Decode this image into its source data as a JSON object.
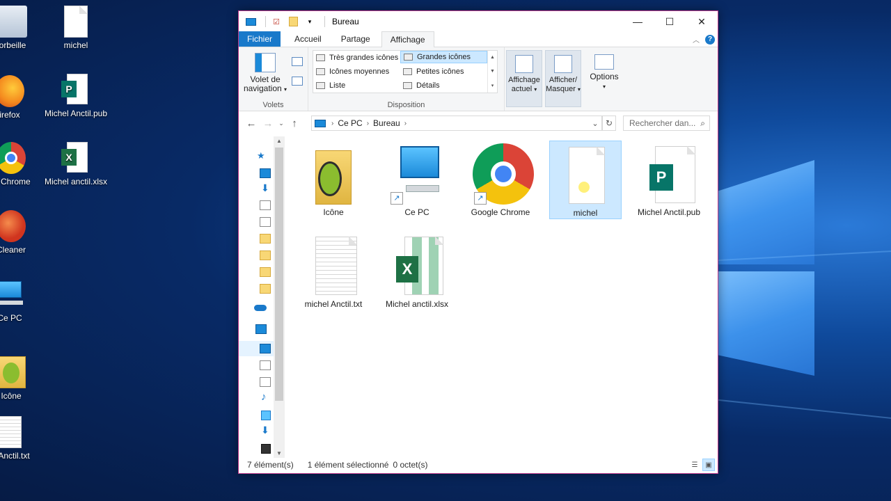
{
  "desktop": {
    "icons": [
      {
        "label": "orbeille"
      },
      {
        "label": "michel"
      },
      {
        "label": "irefox"
      },
      {
        "label": "Michel Anctil.pub"
      },
      {
        "label": "le Chrome"
      },
      {
        "label": "Michel anctil.xlsx"
      },
      {
        "label": "Cleaner"
      },
      {
        "label": "Ce PC"
      },
      {
        "label": "Icône"
      },
      {
        "label": "el Anctil.txt"
      }
    ]
  },
  "window": {
    "title": "Bureau",
    "controls": {
      "minimize": "—",
      "maximize": "☐",
      "close": "✕"
    }
  },
  "ribbon": {
    "tabs": [
      {
        "label": "Fichier"
      },
      {
        "label": "Accueil"
      },
      {
        "label": "Partage"
      },
      {
        "label": "Affichage"
      }
    ],
    "panes_group": {
      "nav_pane_button": "Volet de navigation",
      "label": "Volets"
    },
    "layout_group": {
      "items": [
        {
          "label": "Très grandes icônes"
        },
        {
          "label": "Grandes icônes"
        },
        {
          "label": "Icônes moyennes"
        },
        {
          "label": "Petites icônes"
        },
        {
          "label": "Liste"
        },
        {
          "label": "Détails"
        }
      ],
      "selected": "Grandes icônes",
      "label": "Disposition"
    },
    "current_view": "Affichage actuel",
    "show_hide": "Afficher/ Masquer",
    "options": "Options"
  },
  "address": {
    "crumbs": [
      "Ce PC",
      "Bureau"
    ],
    "search_placeholder": "Rechercher dan..."
  },
  "files": [
    {
      "name": "Icône",
      "type": "folder"
    },
    {
      "name": "Ce PC",
      "type": "computer",
      "shortcut": true
    },
    {
      "name": "Google Chrome",
      "type": "chrome",
      "shortcut": true
    },
    {
      "name": "michel",
      "type": "blank",
      "selected": true
    },
    {
      "name": "Michel Anctil.pub",
      "type": "publisher"
    },
    {
      "name": "michel Anctil.txt",
      "type": "text"
    },
    {
      "name": "Michel anctil.xlsx",
      "type": "excel"
    }
  ],
  "status": {
    "count": "7 élément(s)",
    "selection": "1 élément sélectionné",
    "size": "0 octet(s)"
  },
  "colors": {
    "accent": "#1979ca",
    "selection": "#cce8ff",
    "window_border": "#c0398b"
  }
}
